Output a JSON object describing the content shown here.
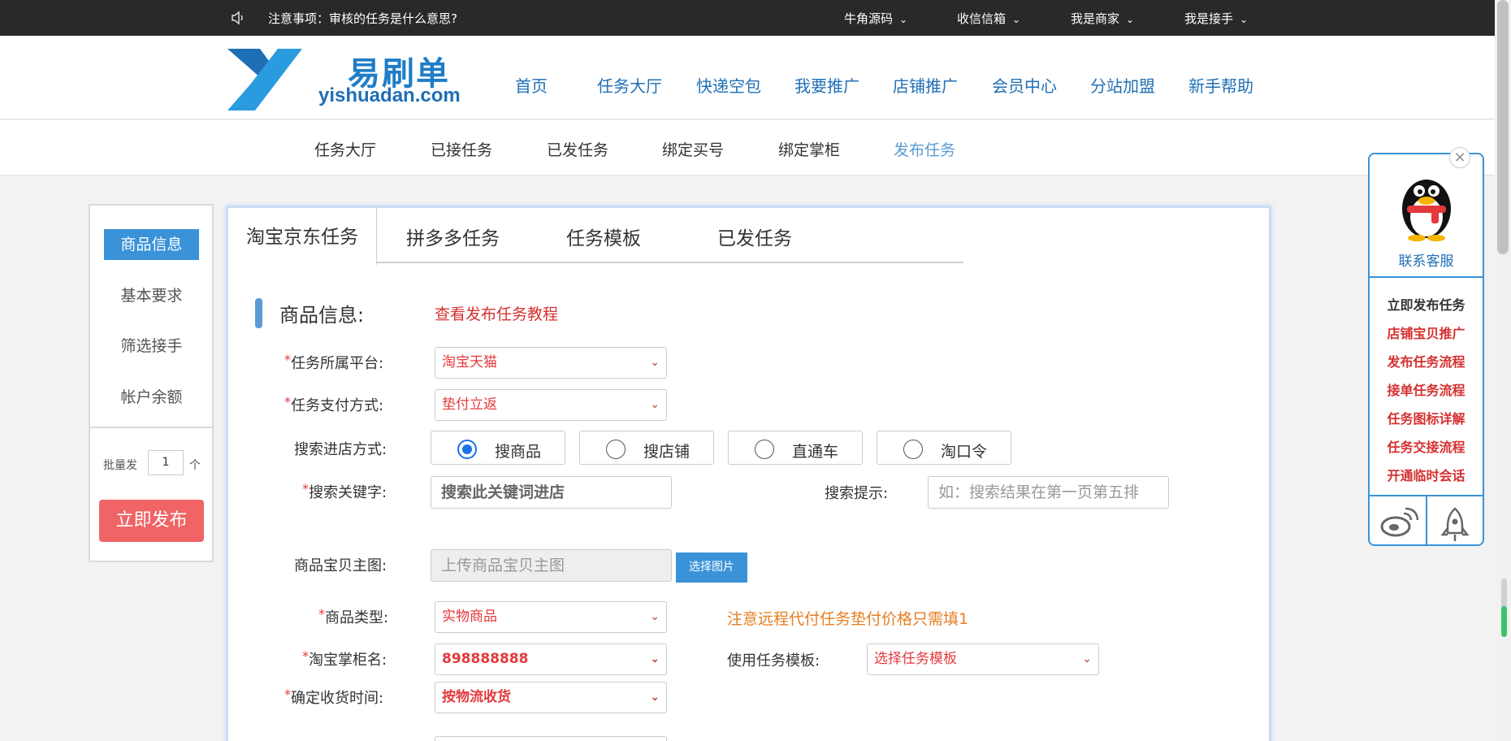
{
  "topbar": {
    "notice": "注意事项：审核的任务是什么意思?",
    "menus": [
      "牛角源码",
      "收信信箱",
      "我是商家",
      "我是接手"
    ]
  },
  "logo": {
    "cn": "易刷单",
    "en": "yishuadan.com"
  },
  "main_nav": [
    "首页",
    "任务大厅",
    "快递空包",
    "我要推广",
    "店铺推广",
    "会员中心",
    "分站加盟",
    "新手帮助"
  ],
  "sub_nav": {
    "items": [
      "任务大厅",
      "已接任务",
      "已发任务",
      "绑定买号",
      "绑定掌柜",
      "发布任务"
    ],
    "active": "发布任务"
  },
  "sidebar": {
    "items": [
      "商品信息",
      "基本要求",
      "筛选接手",
      "帐户余额"
    ],
    "batch_label": "批量发",
    "batch_value": "1",
    "batch_unit": "个",
    "publish_button": "立即发布"
  },
  "tabs": [
    "淘宝京东任务",
    "拼多多任务",
    "任务模板",
    "已发任务"
  ],
  "section": {
    "title": "商品信息:",
    "tutorial_link": "查看发布任务教程"
  },
  "form": {
    "required_mark": "*",
    "platform_label": "任务所属平台:",
    "platform_value": "淘宝天猫",
    "payment_label": "任务支付方式:",
    "payment_value": "垫付立返",
    "search_method_label": "搜索进店方式:",
    "search_options": [
      "搜商品",
      "搜店铺",
      "直通车",
      "淘口令"
    ],
    "search_selected": "搜商品",
    "keyword_label": "搜索关键字:",
    "keyword_placeholder": "搜索此关键词进店",
    "hint_label": "搜索提示:",
    "hint_placeholder": "如：搜索结果在第一页第五排",
    "main_image_label": "商品宝贝主图:",
    "main_image_placeholder": "上传商品宝贝主图",
    "choose_image_button": "选择图片",
    "product_type_label": "商品类型:",
    "product_type_value": "实物商品",
    "product_type_warning": "注意远程代付任务垫付价格只需填1",
    "shopkeeper_label": "淘宝掌柜名:",
    "shopkeeper_value": "898888888",
    "template_label": "使用任务模板:",
    "template_value": "选择任务模板",
    "receive_time_label": "确定收货时间:",
    "receive_time_value": "按物流收货"
  },
  "widget": {
    "service_label": "联系客服",
    "links": [
      "立即发布任务",
      "店铺宝贝推广",
      "发布任务流程",
      "接单任务流程",
      "任务图标详解",
      "任务交接流程",
      "开通临时会话"
    ],
    "close_glyph": "×"
  },
  "colors": {
    "topbar_bg": "#2b2927",
    "brand_blue": "#1f6fb6",
    "accent_blue": "#3a92d8",
    "red": "#e4393c",
    "publish_btn": "#f06466",
    "warning_orange": "#e67e22"
  }
}
